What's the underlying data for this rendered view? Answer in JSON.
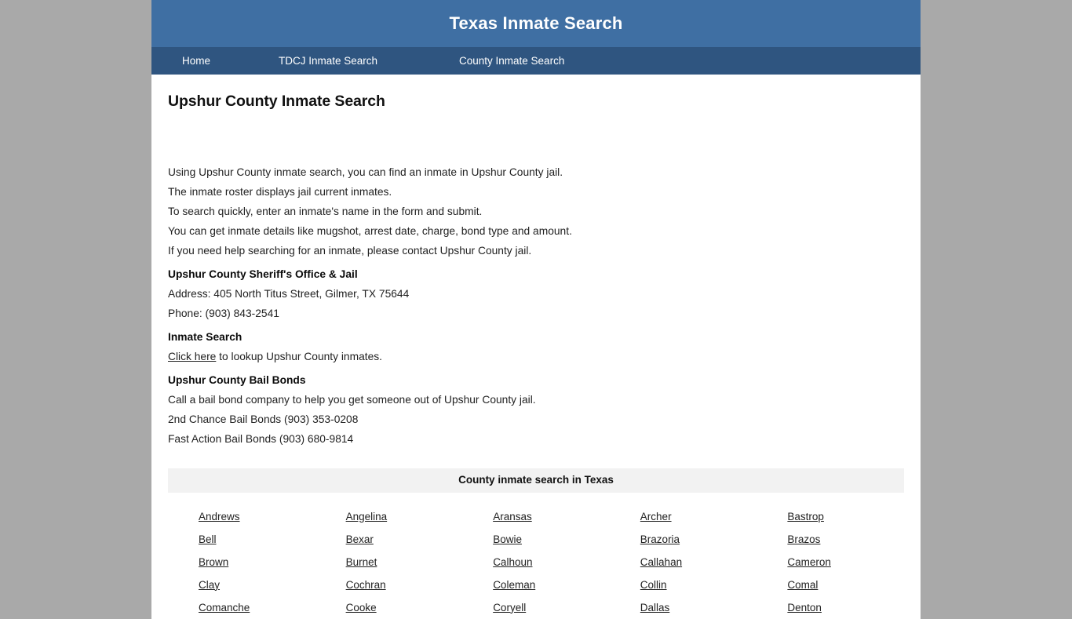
{
  "site": {
    "title": "Texas Inmate Search",
    "header_bg": "#3f6fa3",
    "nav_bg": "#2f5580",
    "page_bg": "#a9a9a9"
  },
  "nav": {
    "items": [
      {
        "label": "Home"
      },
      {
        "label": "TDCJ Inmate Search"
      },
      {
        "label": "County Inmate Search"
      }
    ]
  },
  "main": {
    "page_title": "Upshur County Inmate Search",
    "intro_lines": [
      "Using Upshur County inmate search, you can find an inmate in Upshur County jail.",
      "The inmate roster displays jail current inmates.",
      "To search quickly, enter an inmate's name in the form and submit.",
      "You can get inmate details like mugshot, arrest date, charge, bond type and amount.",
      "If you need help searching for an inmate, please contact Upshur County jail."
    ],
    "office": {
      "heading": "Upshur County Sheriff's Office & Jail",
      "address": "Address: 405 North Titus Street, Gilmer, TX 75644",
      "phone": "Phone: (903) 843-2541"
    },
    "inmate_search": {
      "heading": "Inmate Search",
      "link_text": "Click here",
      "rest_text": " to lookup Upshur County inmates."
    },
    "bail_bonds": {
      "heading": "Upshur County Bail Bonds",
      "intro": "Call a bail bond company to help you get someone out of Upshur County jail.",
      "companies": [
        "2nd Chance Bail Bonds (903) 353-0208",
        "Fast Action Bail Bonds (903) 680-9814"
      ]
    }
  },
  "county_table": {
    "header": "County inmate search in Texas",
    "counties": [
      "Andrews",
      "Angelina",
      "Aransas",
      "Archer",
      "Bastrop",
      "Bell",
      "Bexar",
      "Bowie",
      "Brazoria",
      "Brazos",
      "Brown",
      "Burnet",
      "Calhoun",
      "Callahan",
      "Cameron",
      "Clay",
      "Cochran",
      "Coleman",
      "Collin",
      "Comal",
      "Comanche",
      "Cooke",
      "Coryell",
      "Dallas",
      "Denton"
    ]
  }
}
